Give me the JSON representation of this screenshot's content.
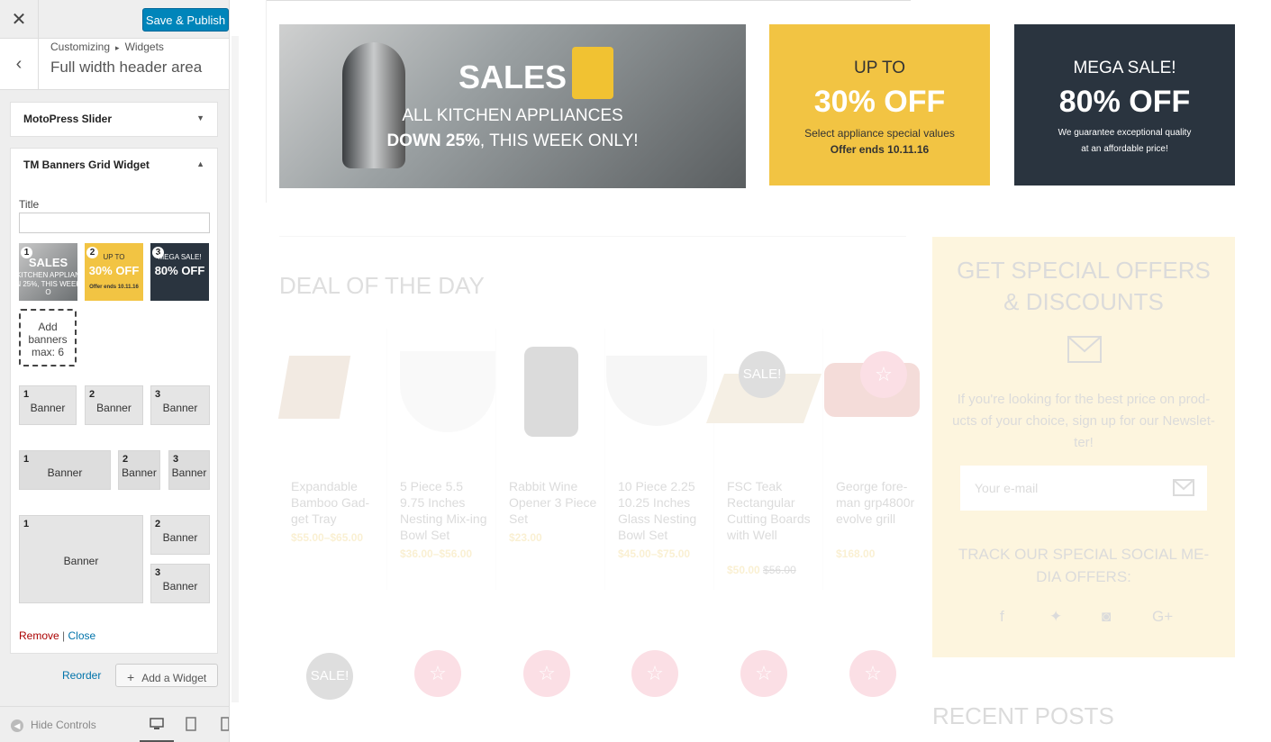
{
  "topbar": {
    "close_icon": "close-icon",
    "save_label": "Save & Publish"
  },
  "section": {
    "breadcrumb_parent": "Customizing",
    "breadcrumb_sep": "▸",
    "breadcrumb_child": "Widgets",
    "title": "Full width header area"
  },
  "widgets": [
    {
      "title": "MotoPress Slider",
      "expanded": false
    },
    {
      "title": "TM Banners Grid Widget",
      "expanded": true
    }
  ],
  "banners_widget": {
    "title_label": "Title",
    "title_value": "",
    "thumbs": [
      {
        "num": "1",
        "line1": "SALES",
        "line2": "KITCHEN APPLIAN",
        "line3": "N 25%, THIS WEEK O"
      },
      {
        "num": "2",
        "line1": "UP TO",
        "line2": "30% OFF",
        "line3": "Offer ends 10.11.16"
      },
      {
        "num": "3",
        "line1": "MEGA SALE!",
        "line2": "80% OFF",
        "line3": ""
      }
    ],
    "add_label_1": "Add",
    "add_label_2": "banners",
    "add_label_3": "max: 6",
    "layout_banner_label": "Banner",
    "layouts": [
      {
        "cells": [
          "1",
          "2",
          "3"
        ]
      },
      {
        "cells": [
          "1",
          "2",
          "3"
        ]
      },
      {
        "cells": [
          "1",
          "2",
          "3"
        ]
      }
    ],
    "remove_label": "Remove",
    "pipe": "|",
    "close_label": "Close"
  },
  "actions": {
    "reorder_label": "Reorder",
    "add_widget_label": "Add a Widget",
    "add_widget_plus": "+"
  },
  "footer": {
    "hide_controls": "Hide Controls"
  },
  "preview": {
    "banner1": {
      "title": "SALES",
      "line1": "ALL KITCHEN APPLIANCES",
      "line2_bold": "DOWN 25%",
      "line2_rest": ", THIS WEEK ONLY!"
    },
    "banner2": {
      "line1": "UP TO",
      "line2": "30% OFF",
      "line3": "Select appliance special values",
      "line4": "Offer ends 10.11.16"
    },
    "banner3": {
      "line1": "MEGA SALE!",
      "line2": "80% OFF",
      "line3": "We guarantee exceptional quality",
      "line4": "at an affordable price!"
    },
    "deal_title": "DEAL OF THE DAY",
    "sale_badge": "SALE!",
    "products": [
      {
        "name": "Expandable Bamboo Gad-get Tray",
        "price": "$55.00–$65.00"
      },
      {
        "name": "5 Piece 5.5 9.75 Inches Nesting Mix-ing Bowl Set",
        "price": "$36.00–$56.00"
      },
      {
        "name": "Rabbit Wine Opener 3 Piece Set",
        "price": "$23.00"
      },
      {
        "name": "10 Piece 2.25 10.25 Inches Glass Nesting Bowl Set",
        "price": "$45.00–$75.00"
      },
      {
        "name": "FSC Teak Rectangular Cutting Boards with Well",
        "price": "$50.00",
        "old_price": "$56.00"
      },
      {
        "name": "George fore-man grp4800r evolve grill",
        "price": "$168.00"
      }
    ],
    "offers": {
      "title_1": "GET SPECIAL OFFERS",
      "title_2": "& DISCOUNTS",
      "text_1": "If you're looking for the best price on prod-",
      "text_2": "ucts of your choice, sign up for our Newslet-",
      "text_3": "ter!",
      "email_placeholder": "Your e-mail",
      "social_title_1": "TRACK OUR SPECIAL SOCIAL ME-",
      "social_title_2": "DIA OFFERS:"
    },
    "recent_posts": "RECENT POSTS"
  }
}
